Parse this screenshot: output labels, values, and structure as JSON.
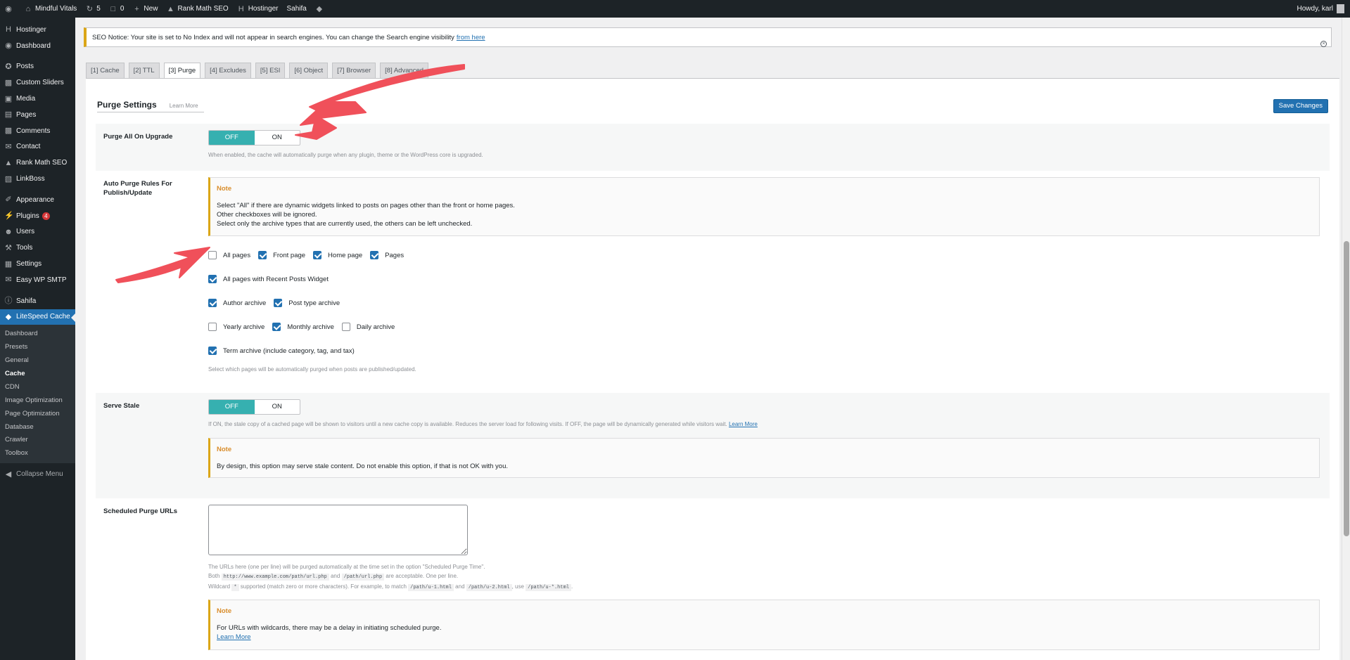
{
  "adminbar": {
    "site_name": "Mindful Vitals",
    "updates_count": "5",
    "comments_count": "0",
    "new_label": "New",
    "rankmath_label": "Rank Math SEO",
    "hostinger_label": "Hostinger",
    "theme_label": "Sahifa",
    "howdy": "Howdy, karl"
  },
  "sidebar": {
    "items": [
      {
        "label": "Hostinger",
        "icon": "hostinger-icon"
      },
      {
        "label": "Dashboard",
        "icon": "dashboard-icon"
      },
      {
        "label": "Posts",
        "icon": "pin-icon"
      },
      {
        "label": "Custom Sliders",
        "icon": "comment-icon"
      },
      {
        "label": "Media",
        "icon": "media-icon"
      },
      {
        "label": "Pages",
        "icon": "pages-icon"
      },
      {
        "label": "Comments",
        "icon": "comment-icon"
      },
      {
        "label": "Contact",
        "icon": "mail-icon"
      },
      {
        "label": "Rank Math SEO",
        "icon": "rankmath-icon"
      },
      {
        "label": "LinkBoss",
        "icon": "linkboss-icon"
      },
      {
        "label": "Appearance",
        "icon": "brush-icon"
      },
      {
        "label": "Plugins",
        "icon": "plug-icon",
        "badge": "4"
      },
      {
        "label": "Users",
        "icon": "user-icon"
      },
      {
        "label": "Tools",
        "icon": "wrench-icon"
      },
      {
        "label": "Settings",
        "icon": "settings-icon"
      },
      {
        "label": "Easy WP SMTP",
        "icon": "smtp-icon"
      },
      {
        "label": "Sahifa",
        "icon": "info-icon"
      },
      {
        "label": "LiteSpeed Cache",
        "icon": "litespeed-icon"
      }
    ],
    "submenu": [
      "Dashboard",
      "Presets",
      "General",
      "Cache",
      "CDN",
      "Image Optimization",
      "Page Optimization",
      "Database",
      "Crawler",
      "Toolbox"
    ],
    "collapse_label": "Collapse Menu"
  },
  "notice": {
    "text": "SEO Notice: Your site is set to No Index and will not appear in search engines. You can change the Search engine visibility",
    "link": "from here"
  },
  "tabs": [
    "[1] Cache",
    "[2] TTL",
    "[3] Purge",
    "[4] Excludes",
    "[5] ESI",
    "[6] Object",
    "[7] Browser",
    "[8] Advanced"
  ],
  "purge": {
    "title": "Purge Settings",
    "learn_more": "Learn More",
    "save_label": "Save Changes",
    "toggle_off": "OFF",
    "toggle_on": "ON",
    "upgrade": {
      "label": "Purge All On Upgrade",
      "value": "OFF",
      "desc": "When enabled, the cache will automatically purge when any plugin, theme or the WordPress core is upgraded."
    },
    "auto": {
      "label": "Auto Purge Rules For Publish/Update",
      "note_title": "Note",
      "note_lines": [
        "Select \"All\" if there are dynamic widgets linked to posts on pages other than the front or home pages.",
        "Other checkboxes will be ignored.",
        "Select only the archive types that are currently used, the others can be left unchecked."
      ],
      "checkbox_rows": [
        [
          {
            "label": "All pages",
            "checked": false
          },
          {
            "label": "Front page",
            "checked": true
          },
          {
            "label": "Home page",
            "checked": true
          },
          {
            "label": "Pages",
            "checked": true
          }
        ],
        [
          {
            "label": "All pages with Recent Posts Widget",
            "checked": true
          }
        ],
        [
          {
            "label": "Author archive",
            "checked": true
          },
          {
            "label": "Post type archive",
            "checked": true
          }
        ],
        [
          {
            "label": "Yearly archive",
            "checked": false
          },
          {
            "label": "Monthly archive",
            "checked": true
          },
          {
            "label": "Daily archive",
            "checked": false
          }
        ],
        [
          {
            "label": "Term archive (include category, tag, and tax)",
            "checked": true
          }
        ]
      ],
      "desc": "Select which pages will be automatically purged when posts are published/updated."
    },
    "stale": {
      "label": "Serve Stale",
      "value": "OFF",
      "desc": "If ON, the stale copy of a cached page will be shown to visitors until a new cache copy is available. Reduces the server load for following visits. If OFF, the page will be dynamically generated while visitors wait.",
      "desc_link": "Learn More",
      "note_title": "Note",
      "note_line": "By design, this option may serve stale content. Do not enable this option, if that is not OK with you."
    },
    "scheduled": {
      "label": "Scheduled Purge URLs",
      "value": "",
      "desc1": "The URLs here (one per line) will be purged automatically at the time set in the option \"Scheduled Purge Time\".",
      "desc2_a": "Both",
      "code1": "http://www.example.com/path/url.php",
      "desc2_b": "and",
      "code2": "/path/url.php",
      "desc2_c": "are acceptable. One per line.",
      "desc3_a": "Wildcard",
      "code3": "*",
      "desc3_b": "supported (match zero or more characters). For example, to match",
      "code4": "/path/u-1.html",
      "desc3_c": "and",
      "code5": "/path/u-2.html",
      "desc3_d": ", use",
      "code6": "/path/u-*.html",
      "desc3_e": ".",
      "note_title": "Note",
      "note_line": "For URLs with wildcards, there may be a delay in initiating scheduled purge.",
      "note_link": "Learn More"
    }
  },
  "colors": {
    "toggle_active": "#36b0b0",
    "accent": "#2271b1",
    "arrow": "#f0505a",
    "note_border": "#dba617"
  }
}
